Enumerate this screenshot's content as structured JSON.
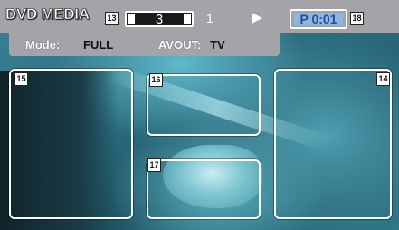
{
  "header": {
    "title": "DVD MEDIA",
    "title_number": "3",
    "chapter": "1",
    "play_icon": "play-icon",
    "time_prefix": "P",
    "time": "0:01"
  },
  "mode_bar": {
    "mode_label": "Mode:",
    "mode_value": "FULL",
    "avout_label": "AVOUT:",
    "avout_value": "TV"
  },
  "callouts": {
    "title_field": "13",
    "time_display": "18",
    "left_zone": "15",
    "center_top_zone": "16",
    "center_bottom_zone": "17",
    "right_zone": "14"
  },
  "colors": {
    "bar": "#a3a3a8",
    "time_text": "#1f4fa0",
    "zone_border": "#ffffff"
  }
}
